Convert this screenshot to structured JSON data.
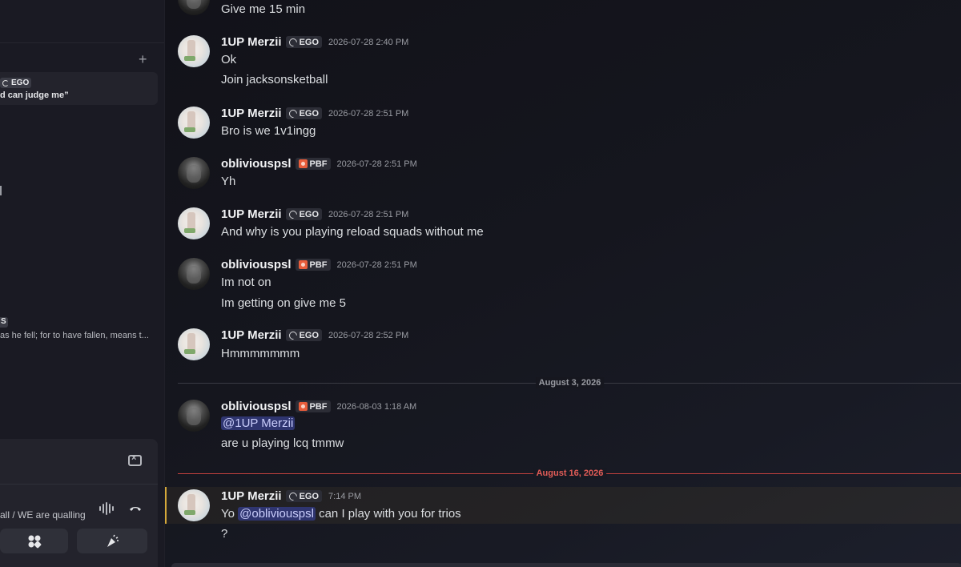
{
  "sidebar": {
    "add_label": "+",
    "card_tag": "EGO",
    "card_quote": "d can judge me”",
    "second_tag": "S",
    "second_quote": "as he fell; for to have fallen, means t...",
    "voice_status": "all / WE are qualling"
  },
  "messages": [
    {
      "id": "m0",
      "user": "",
      "text": [
        "Give me 15 min"
      ],
      "avatar": "obliviouspsl"
    },
    {
      "id": "m1",
      "user": "1UP Merzii",
      "tag": "EGO",
      "time": "2026-07-28 2:40 PM",
      "text": [
        "Ok",
        "Join jacksonsketball"
      ]
    },
    {
      "id": "m2",
      "user": "1UP Merzii",
      "tag": "EGO",
      "time": "2026-07-28 2:51 PM",
      "text": [
        "Bro is we 1v1ingg"
      ]
    },
    {
      "id": "m3",
      "user": "obliviouspsl",
      "tag": "PBF",
      "time": "2026-07-28 2:51 PM",
      "text": [
        "Yh"
      ]
    },
    {
      "id": "m4",
      "user": "1UP Merzii",
      "tag": "EGO",
      "time": "2026-07-28 2:51 PM",
      "text": [
        "And why is you playing reload squads without me"
      ]
    },
    {
      "id": "m5",
      "user": "obliviouspsl",
      "tag": "PBF",
      "time": "2026-07-28 2:51 PM",
      "text": [
        "Im not on",
        "Im getting on give me 5"
      ]
    },
    {
      "id": "m6",
      "user": "1UP Merzii",
      "tag": "EGO",
      "time": "2026-07-28 2:52 PM",
      "text": [
        "Hmmmmmmm"
      ]
    },
    {
      "id": "m7",
      "user": "obliviouspsl",
      "tag": "PBF",
      "time": "2026-08-03 1:18 AM",
      "mention": "@1UP Merzii",
      "text": [
        "are u playing lcq tmmw"
      ]
    },
    {
      "id": "m8",
      "user": "1UP Merzii",
      "tag": "EGO",
      "time": "7:14 PM",
      "text_pre": "Yo ",
      "mention": "@obliviouspsl",
      "text_post": " can I play with you for trios",
      "text": [
        "?"
      ]
    }
  ],
  "dividers": {
    "aug3": "August 3, 2026",
    "aug16": "August 16, 2026"
  },
  "colors": {
    "mention_bg": "#2f3570",
    "new_divider": "#c2413e",
    "highlight_bar": "#d4a83a"
  }
}
